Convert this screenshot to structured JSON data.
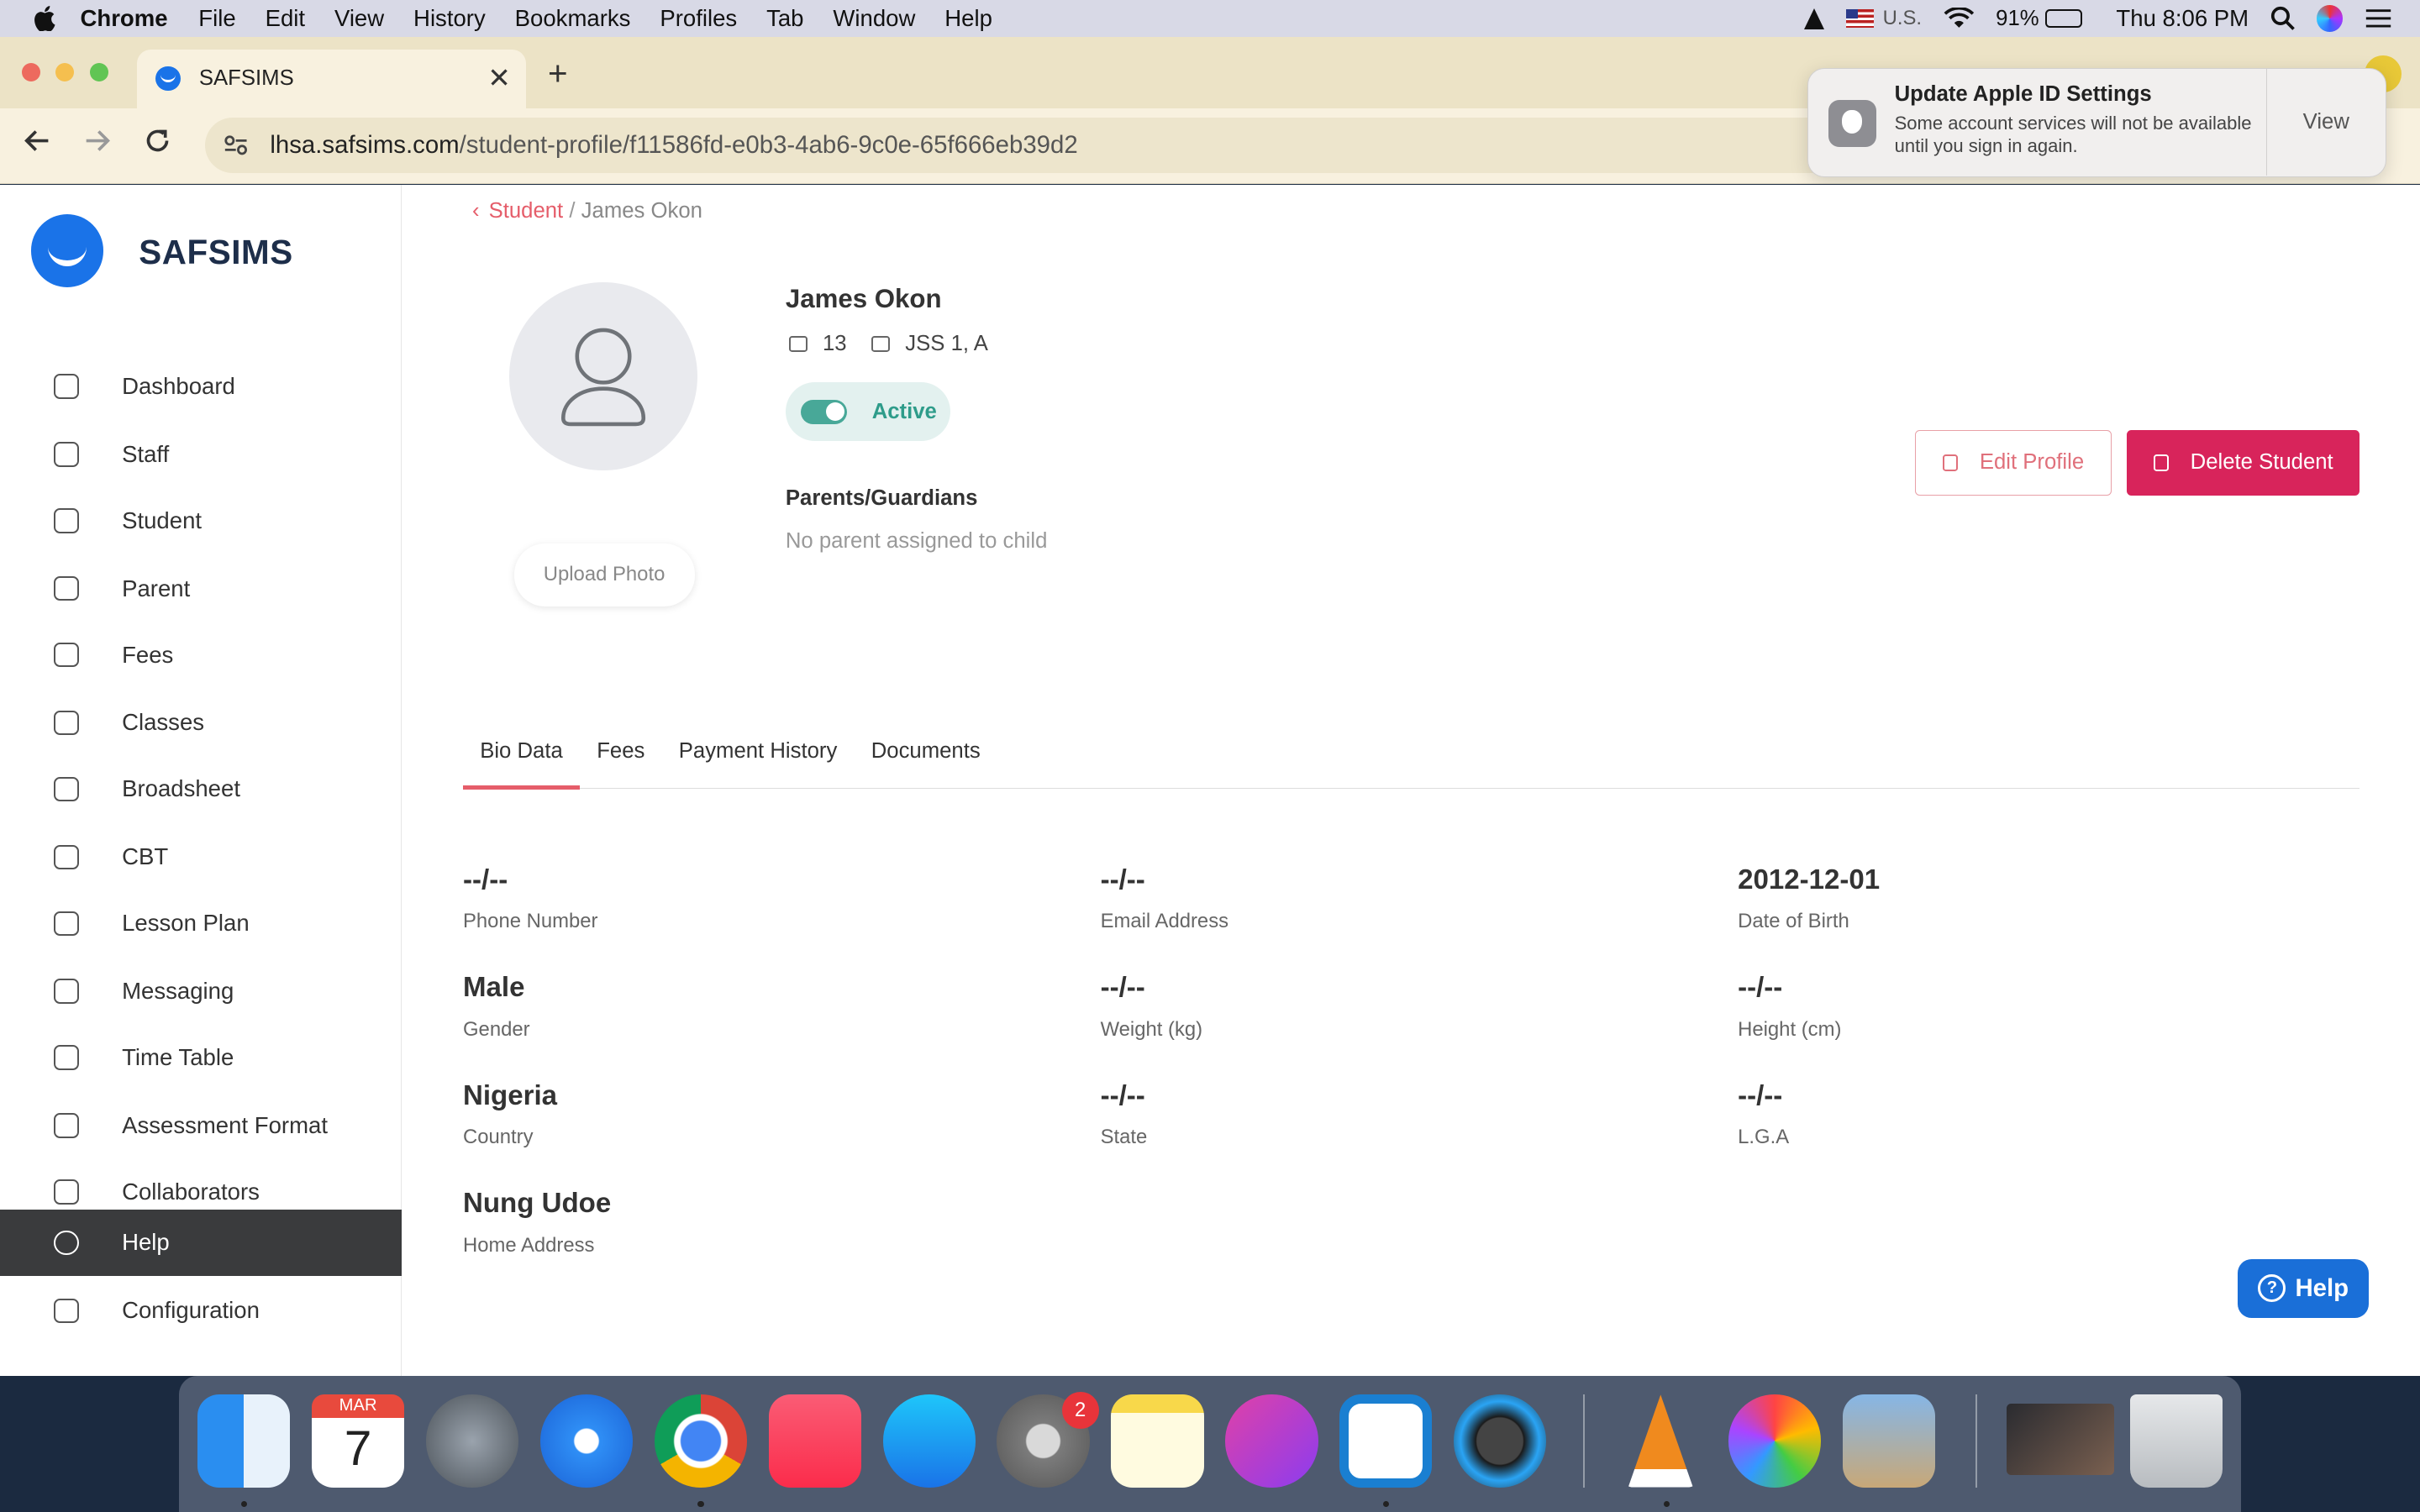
{
  "menubar": {
    "app": "Chrome",
    "items": [
      "File",
      "Edit",
      "View",
      "History",
      "Bookmarks",
      "Profiles",
      "Tab",
      "Window",
      "Help"
    ],
    "input_source": "U.S.",
    "battery": "91%",
    "clock": "Thu 8:06 PM"
  },
  "browser": {
    "tab_title": "SAFSIMS",
    "tab_close": "✕",
    "new_tab": "+",
    "url_host": "lhsa.safsims.com",
    "url_path": "/student-profile/f11586fd-e0b3-4ab6-9c0e-65f666eb39d2"
  },
  "notification": {
    "title": "Update Apple ID Settings",
    "body": "Some account services will not be available until you sign in again.",
    "action": "View"
  },
  "app": {
    "brand": "SAFSIMS",
    "nav": [
      {
        "label": "Dashboard",
        "icon": "dashboard-icon"
      },
      {
        "label": "Staff",
        "icon": "staff-icon"
      },
      {
        "label": "Student",
        "icon": "student-icon"
      },
      {
        "label": "Parent",
        "icon": "parent-icon"
      },
      {
        "label": "Fees",
        "icon": "fees-icon"
      },
      {
        "label": "Classes",
        "icon": "classes-icon"
      },
      {
        "label": "Broadsheet",
        "icon": "broadsheet-icon"
      },
      {
        "label": "CBT",
        "icon": "cbt-icon"
      },
      {
        "label": "Lesson Plan",
        "icon": "lesson-plan-icon"
      },
      {
        "label": "Messaging",
        "icon": "messaging-icon"
      },
      {
        "label": "Time Table",
        "icon": "time-table-icon"
      },
      {
        "label": "Assessment Format",
        "icon": "assessment-format-icon"
      },
      {
        "label": "Collaborators",
        "icon": "collaborators-icon"
      },
      {
        "label": "Help",
        "icon": "help-icon",
        "active": true
      },
      {
        "label": "Configuration",
        "icon": "configuration-icon"
      }
    ]
  },
  "breadcrumb": {
    "parent": "Student",
    "separator": "/",
    "current": "James Okon"
  },
  "student": {
    "name": "James Okon",
    "age": "13",
    "class": "JSS 1, A",
    "status": "Active",
    "upload_label": "Upload Photo",
    "guardians_label": "Parents/Guardians",
    "guardians_value": "No parent assigned to child"
  },
  "actions": {
    "edit": "Edit Profile",
    "delete": "Delete Student"
  },
  "tabs": [
    "Bio Data",
    "Fees",
    "Payment History",
    "Documents"
  ],
  "bio": [
    {
      "value": "--/--",
      "label": "Phone Number"
    },
    {
      "value": "--/--",
      "label": "Email Address"
    },
    {
      "value": "2012-12-01",
      "label": "Date of Birth"
    },
    {
      "value": "Male",
      "label": "Gender"
    },
    {
      "value": "--/--",
      "label": "Weight (kg)"
    },
    {
      "value": "--/--",
      "label": "Height (cm)"
    },
    {
      "value": "Nigeria",
      "label": "Country"
    },
    {
      "value": "--/--",
      "label": "State"
    },
    {
      "value": "--/--",
      "label": "L.G.A"
    },
    {
      "value": "Nung Udoe",
      "label": "Home Address"
    }
  ],
  "help_button": "Help",
  "dock": {
    "calendar_month": "MAR",
    "calendar_day": "7",
    "settings_badge": "2"
  }
}
